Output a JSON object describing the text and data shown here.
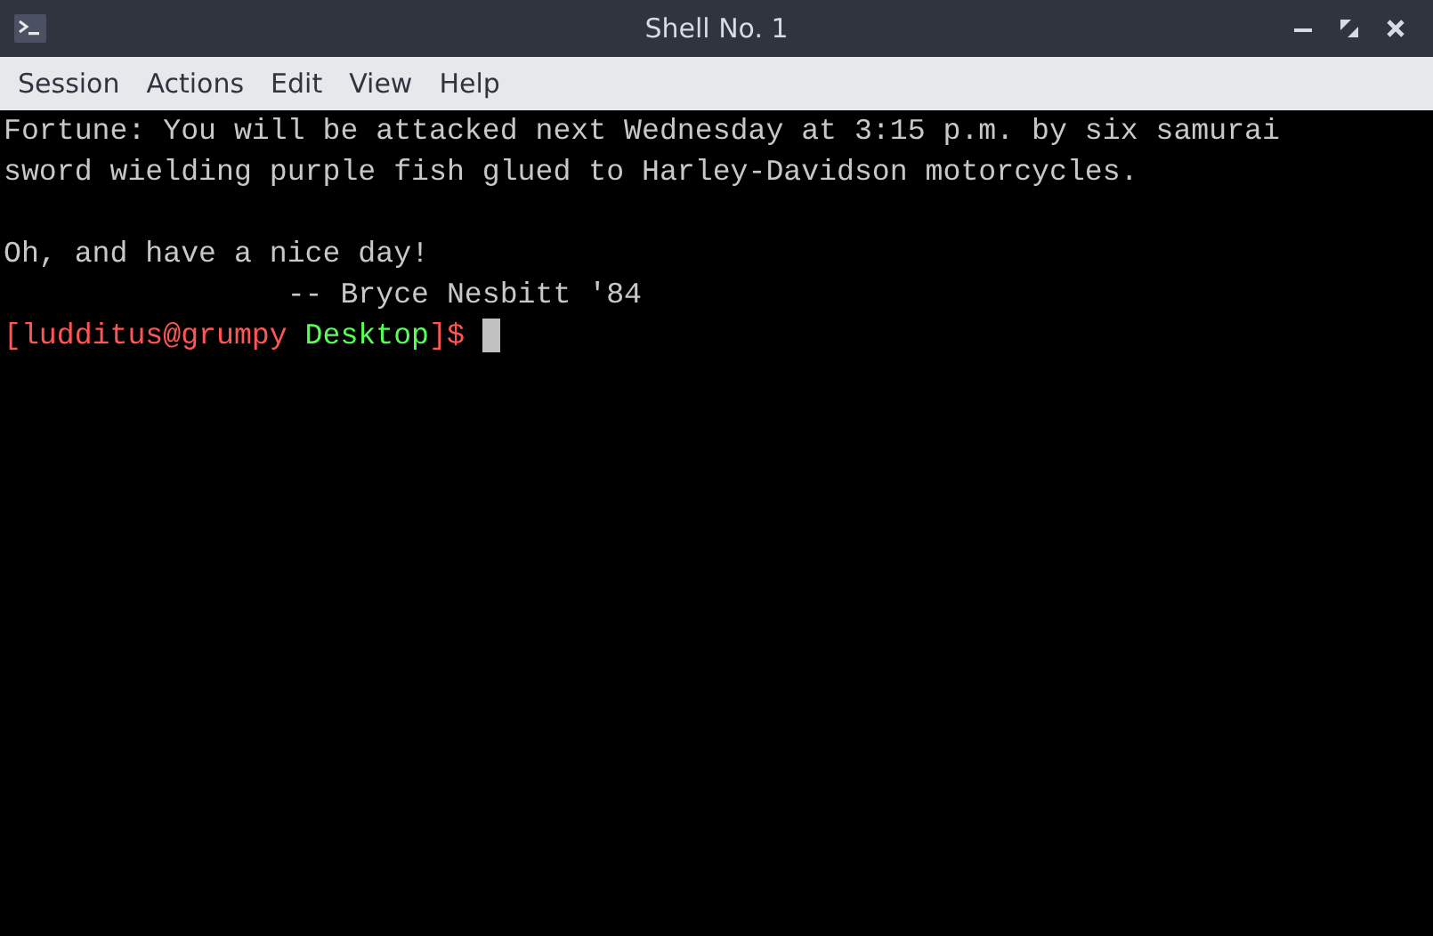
{
  "window": {
    "title": "Shell No. 1",
    "buttons": [
      {
        "kind": "minimize"
      },
      {
        "kind": "restore"
      },
      {
        "kind": "close"
      }
    ]
  },
  "menu": [
    "Session",
    "Actions",
    "Edit",
    "View",
    "Help"
  ],
  "terminal": {
    "paragraphs": [
      [
        "Fortune: You will be attacked next Wednesday at 3:15 p.m. by six samurai",
        "sword wielding purple fish glued to Harley-Davidson motorcycles."
      ],
      [
        "Oh, and have a nice day!",
        "                -- Bryce Nesbitt '84"
      ]
    ],
    "prompt": [
      {
        "text": "[ludditus@grumpy ",
        "color": "#ff5555"
      },
      {
        "text": "Desktop",
        "color": "#55ff55"
      },
      {
        "text": "]$",
        "color": "#ff5555"
      }
    ],
    "cursor": true
  }
}
